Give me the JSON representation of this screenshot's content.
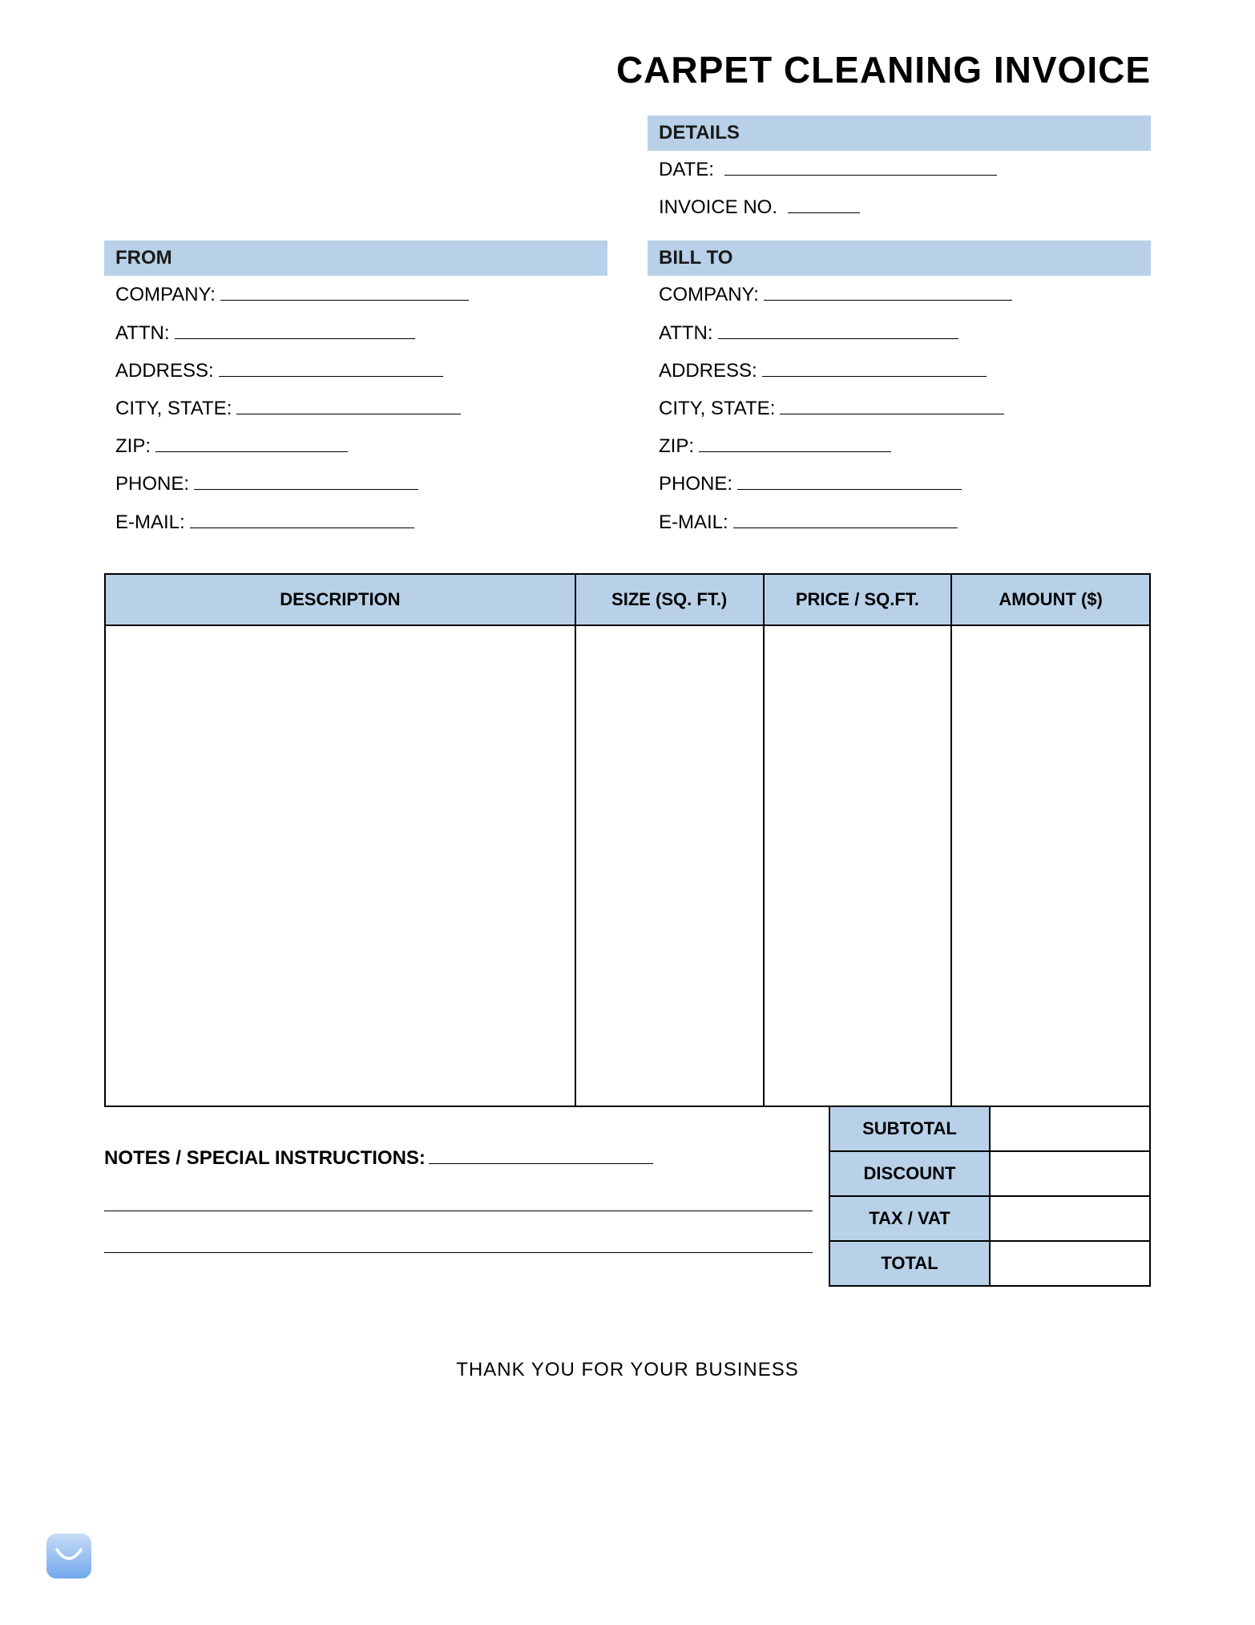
{
  "title": "CARPET CLEANING INVOICE",
  "details": {
    "header": "DETAILS",
    "date_label": "DATE:",
    "invoice_no_label": "INVOICE NO."
  },
  "from": {
    "header": "FROM",
    "company_label": "COMPANY:",
    "attn_label": "ATTN:",
    "address_label": "ADDRESS:",
    "city_state_label": "CITY, STATE:",
    "zip_label": "ZIP:",
    "phone_label": "PHONE:",
    "email_label": "E-MAIL:"
  },
  "billto": {
    "header": "BILL TO",
    "company_label": "COMPANY:",
    "attn_label": "ATTN:",
    "address_label": "ADDRESS:",
    "city_state_label": "CITY, STATE:",
    "zip_label": "ZIP:",
    "phone_label": "PHONE:",
    "email_label": "E-MAIL:"
  },
  "table": {
    "headers": {
      "description": "DESCRIPTION",
      "size": "SIZE (SQ. FT.)",
      "price": "PRICE / SQ.FT.",
      "amount": "AMOUNT ($)"
    }
  },
  "notes": {
    "label": "NOTES / SPECIAL INSTRUCTIONS:"
  },
  "totals": {
    "subtotal": "SUBTOTAL",
    "discount": "DISCOUNT",
    "tax": "TAX / VAT",
    "total": "TOTAL"
  },
  "thankyou": "THANK YOU FOR YOUR BUSINESS"
}
